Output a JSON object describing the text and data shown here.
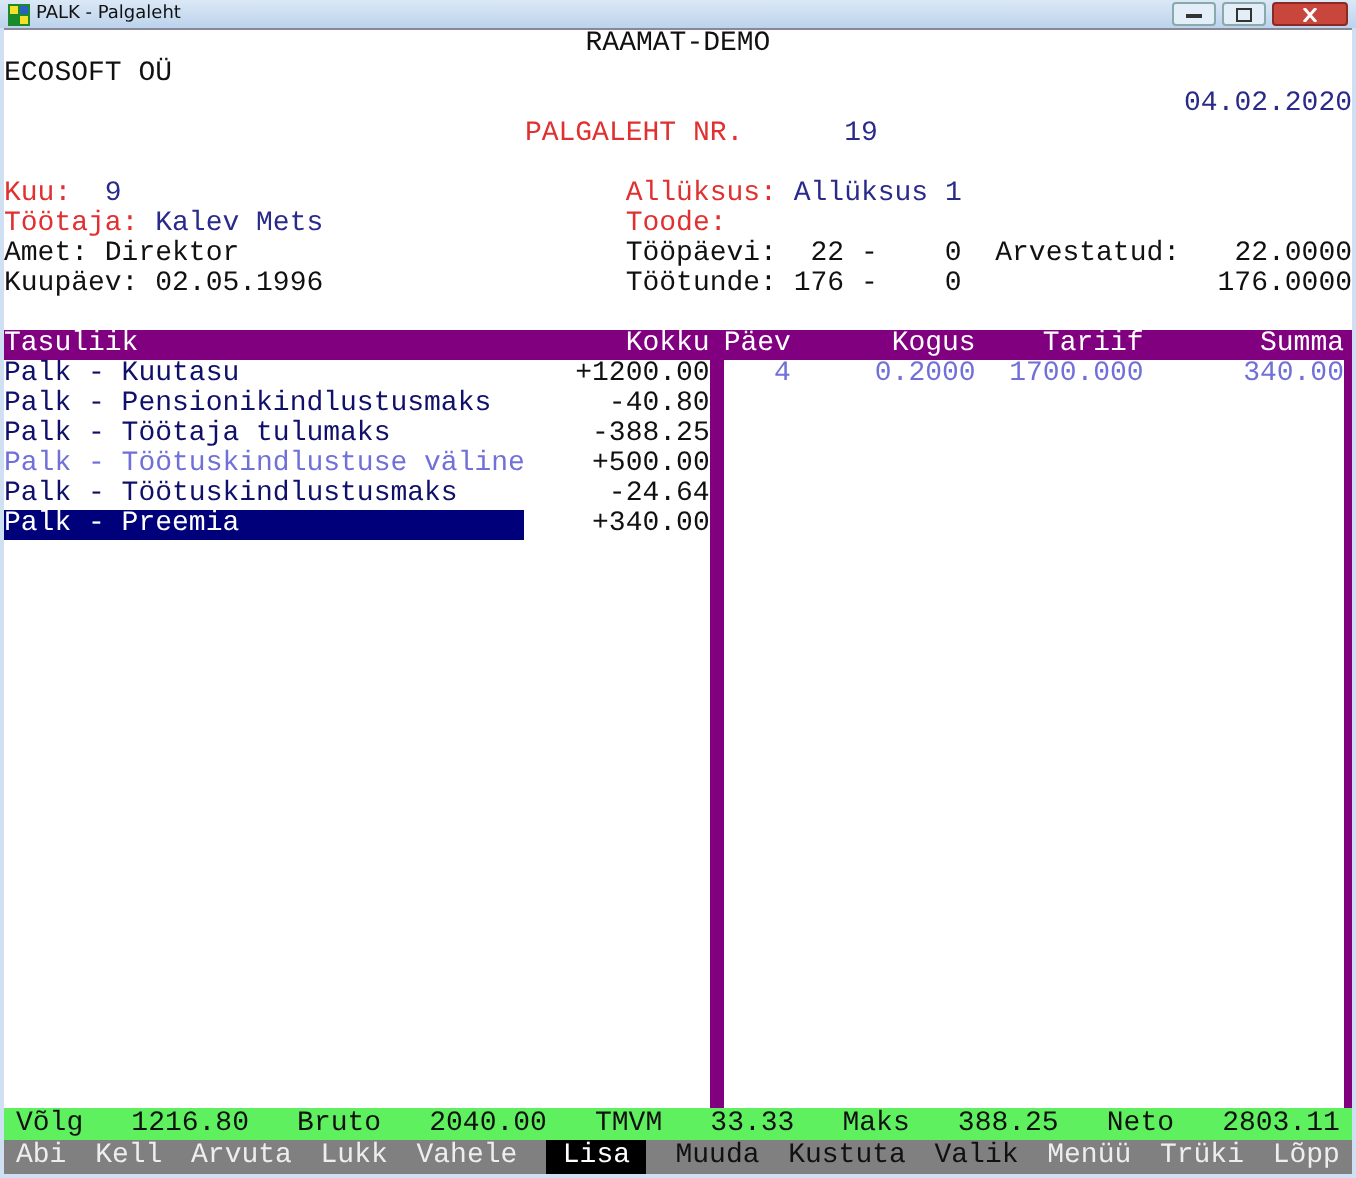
{
  "window": {
    "title": "PALK - Palgaleht"
  },
  "header": {
    "app": "RAAMAT-DEMO",
    "company": "ECOSOFT OÜ",
    "date": "04.02.2020",
    "doc_label": "PALGALEHT NR.",
    "doc_number": "19"
  },
  "info_left": [
    {
      "label": "Kuu:",
      "value": "9",
      "kind": "key"
    },
    {
      "label": "Töötaja:",
      "value": "Kalev Mets",
      "kind": "key"
    },
    {
      "label": "Amet:",
      "value": "Direktor",
      "kind": "plain"
    },
    {
      "label": "Kuupäev:",
      "value": "02.05.1996",
      "kind": "plain"
    }
  ],
  "info_right": {
    "unit_label": "Allüksus:",
    "unit_value": "Allüksus 1",
    "product_label": "Toode:",
    "days_label": "Tööpäevi:",
    "days_a": "22",
    "days_sep": "-",
    "days_b": "0",
    "calc_label": "Arvestatud:",
    "days_calc": "22.0000",
    "hours_label": "Töötunde:",
    "hours_a": "176",
    "hours_sep": "-",
    "hours_b": "0",
    "hours_calc": "176.0000"
  },
  "pay_table": {
    "columns": [
      "Tasuliik",
      "Kokku"
    ],
    "rows": [
      {
        "type": "Palk - Kuutasu",
        "total": "+1200.00",
        "selected": false,
        "disabled": false
      },
      {
        "type": "Palk - Pensionikindlustusmaks",
        "total": "-40.80",
        "selected": false,
        "disabled": false
      },
      {
        "type": "Palk - Töötaja tulumaks",
        "total": "-388.25",
        "selected": false,
        "disabled": false
      },
      {
        "type": "Palk - Töötuskindlustuse väline",
        "total": "+500.00",
        "selected": false,
        "disabled": true
      },
      {
        "type": "Palk - Töötuskindlustusmaks",
        "total": "-24.64",
        "selected": false,
        "disabled": false
      },
      {
        "type": "Palk - Preemia",
        "total": "+340.00",
        "selected": true,
        "disabled": false
      }
    ]
  },
  "detail_table": {
    "columns": [
      "Päev",
      "Kogus",
      "Tariif",
      "Summa"
    ],
    "rows": [
      {
        "day": "4",
        "quantity": "0.2000",
        "rate": "1700.000",
        "sum": "340.00"
      }
    ]
  },
  "status_bar": [
    {
      "label": "Võlg",
      "value": "1216.80"
    },
    {
      "label": "Bruto",
      "value": "2040.00"
    },
    {
      "label": "TMVM",
      "value": "33.33"
    },
    {
      "label": "Maks",
      "value": "388.25"
    },
    {
      "label": "Neto",
      "value": "2803.11"
    }
  ],
  "function_keys": [
    {
      "label": "Abi",
      "selected": false,
      "disabled": true
    },
    {
      "label": "Kell",
      "selected": false,
      "disabled": true
    },
    {
      "label": "Arvuta",
      "selected": false,
      "disabled": true
    },
    {
      "label": "Lukk",
      "selected": false,
      "disabled": true
    },
    {
      "label": "Vahele",
      "selected": false,
      "disabled": true
    },
    {
      "label": "Lisa",
      "selected": true,
      "disabled": false
    },
    {
      "label": "Muuda",
      "selected": false,
      "disabled": false
    },
    {
      "label": "Kustuta",
      "selected": false,
      "disabled": false
    },
    {
      "label": "Valik",
      "selected": false,
      "disabled": false
    },
    {
      "label": "Menüü",
      "selected": false,
      "disabled": true
    },
    {
      "label": "Trüki",
      "selected": false,
      "disabled": true
    },
    {
      "label": "Lõpp",
      "selected": false,
      "disabled": true
    }
  ]
}
